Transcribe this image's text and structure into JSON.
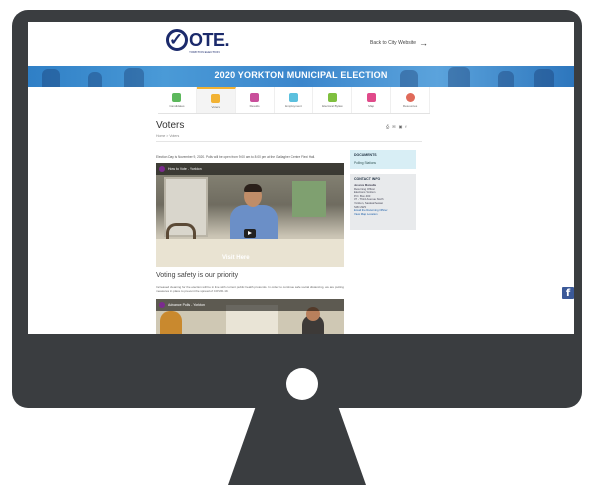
{
  "site": {
    "logo_text": "OTE.",
    "logo_sub": "YORKTON ELECTION",
    "back_link": "Back to City Website",
    "banner_title": "2020 YORKTON MUNICIPAL ELECTION"
  },
  "nav": {
    "items": [
      {
        "label": "Candidates",
        "color": "#5cb85c"
      },
      {
        "label": "Voters",
        "color": "#f2b233"
      },
      {
        "label": "Results",
        "color": "#c94f9b"
      },
      {
        "label": "Employment",
        "color": "#5bc0de"
      },
      {
        "label": "Electoral Bylaw",
        "color": "#7fbf3f"
      },
      {
        "label": "Map",
        "color": "#e04a8a"
      },
      {
        "label": "Resources",
        "color": "#e06a5a"
      }
    ],
    "active_index": 1
  },
  "page": {
    "title": "Voters",
    "breadcrumb": "Home > Voters",
    "share_icons": [
      "print-icon",
      "email-icon",
      "share-icon",
      "facebook-icon"
    ],
    "intro": "Election Day is November 9, 2020. Polls will be open from 9:00 am to 8:00 pm at the Gallagher Centre Flexi Hall.",
    "video1_title": "How to Vote - Yorkton",
    "video1_overlay": "Visit Here",
    "section_heading": "Voting safety is our priority",
    "section_text": "Increased cleaning for the election will be in line with current public health protocols. In order to continue safe social distancing, we are putting measures in place to prevent the spread of COVID-19.",
    "video2_title": "Advance Polls - Yorkton"
  },
  "sidebar": {
    "box1_heading": "DOCUMENTS",
    "box1_item": "Polling Stations",
    "box2_heading": "CONTACT INFO",
    "box2_lines": [
      "Jessica Matsalla",
      "Returning Officer",
      "Elections Yorkton",
      "P.O. Box 400",
      "37 - Third Avenue North",
      "Yorkton, Saskatchewan",
      "S3N 2W3"
    ],
    "box2_links": [
      "Email the Returning Officer",
      "View Map Location"
    ]
  },
  "colors": {
    "bezel": "#3a3d40",
    "brand": "#1b2a6b",
    "facebook": "#3b5998"
  }
}
